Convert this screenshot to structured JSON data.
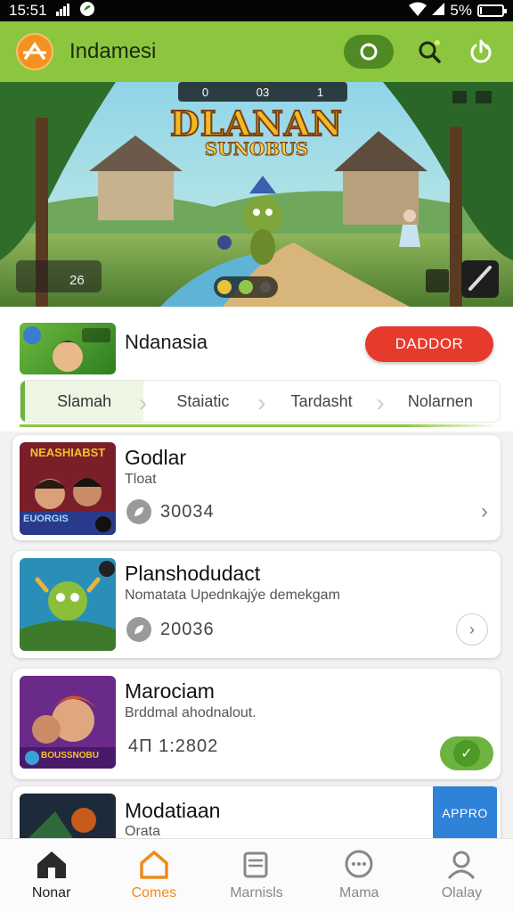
{
  "status_bar": {
    "time": "15:51",
    "battery": "5%",
    "battery_level": 0.05
  },
  "app_bar": {
    "title": "Indamesi"
  },
  "hero": {
    "title_top": "DLANAN",
    "title_bottom": "SUNOBUS",
    "hud_left": "0",
    "hud_mid": "03",
    "hud_right": "1",
    "corner_label": "26"
  },
  "featured": {
    "name": "Ndanasia",
    "download_label": "DADDOR",
    "tabs": [
      "Slamah",
      "Staiatic",
      "Tardasht",
      "Nolarnen"
    ]
  },
  "games": [
    {
      "title": "Godlar",
      "subtitle": "Tloat",
      "meta": "30034",
      "action": "chevron",
      "art": "NEASHIABST",
      "art_bottom": "EUORGIS"
    },
    {
      "title": "Planshodudact",
      "subtitle": "Nomatata Upednkajýe demekgam",
      "meta": "20036",
      "action": "circle-chevron"
    },
    {
      "title": "Marociam",
      "subtitle": "Brddmal ahodnalout.",
      "meta": "4Π 1:2802",
      "action": "toggle",
      "art_bottom": "BOUSSNOBU"
    },
    {
      "title": "Modatiaan",
      "subtitle": "Orata",
      "action": "apply",
      "action_label": "APPRO"
    }
  ],
  "bottom_nav": [
    {
      "label": "Nonar",
      "icon": "home-icon"
    },
    {
      "label": "Comes",
      "icon": "house-outline-icon"
    },
    {
      "label": "Marnisls",
      "icon": "stack-icon"
    },
    {
      "label": "Mama",
      "icon": "chat-bubble-icon"
    },
    {
      "label": "Olalay",
      "icon": "profile-icon"
    }
  ],
  "colors": {
    "accent_green": "#8cc63f",
    "download_red": "#e53a2c",
    "active_orange": "#f08a1c",
    "apply_blue": "#2e82d8"
  }
}
